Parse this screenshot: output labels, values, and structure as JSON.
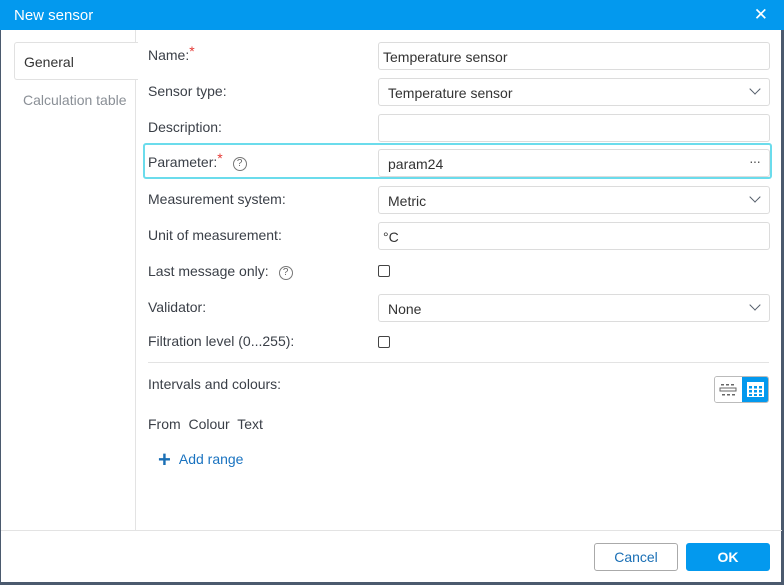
{
  "dialog": {
    "title": "New sensor",
    "close_icon": "close-icon"
  },
  "tabs": [
    {
      "label": "General",
      "active": true
    },
    {
      "label": "Calculation table",
      "active": false
    }
  ],
  "form": {
    "name": {
      "label": "Name:",
      "value": "Temperature sensor"
    },
    "sensor_type": {
      "label": "Sensor type:",
      "value": "Temperature sensor"
    },
    "description": {
      "label": "Description:",
      "value": ""
    },
    "parameter": {
      "label": "Parameter:",
      "value": "param24",
      "more": "···"
    },
    "measurement_system": {
      "label": "Measurement system:",
      "value": "Metric"
    },
    "unit": {
      "label": "Unit of measurement:",
      "value": "°C"
    },
    "last_message_only": {
      "label": "Last message only:",
      "checked": false
    },
    "validator": {
      "label": "Validator:",
      "value": "None"
    },
    "filtration": {
      "label": "Filtration level (0...255):",
      "checked": false
    },
    "required_mark": "*",
    "help": "?"
  },
  "intervals": {
    "label": "Intervals and colours:",
    "columns": [
      "From",
      "Colour",
      "Text"
    ],
    "add_range": "Add range",
    "view_mode": "grid"
  },
  "footer": {
    "cancel": "Cancel",
    "ok": "OK"
  },
  "colors": {
    "accent": "#0399ee",
    "focus": "#6bdcec",
    "link": "#1a73c0"
  }
}
